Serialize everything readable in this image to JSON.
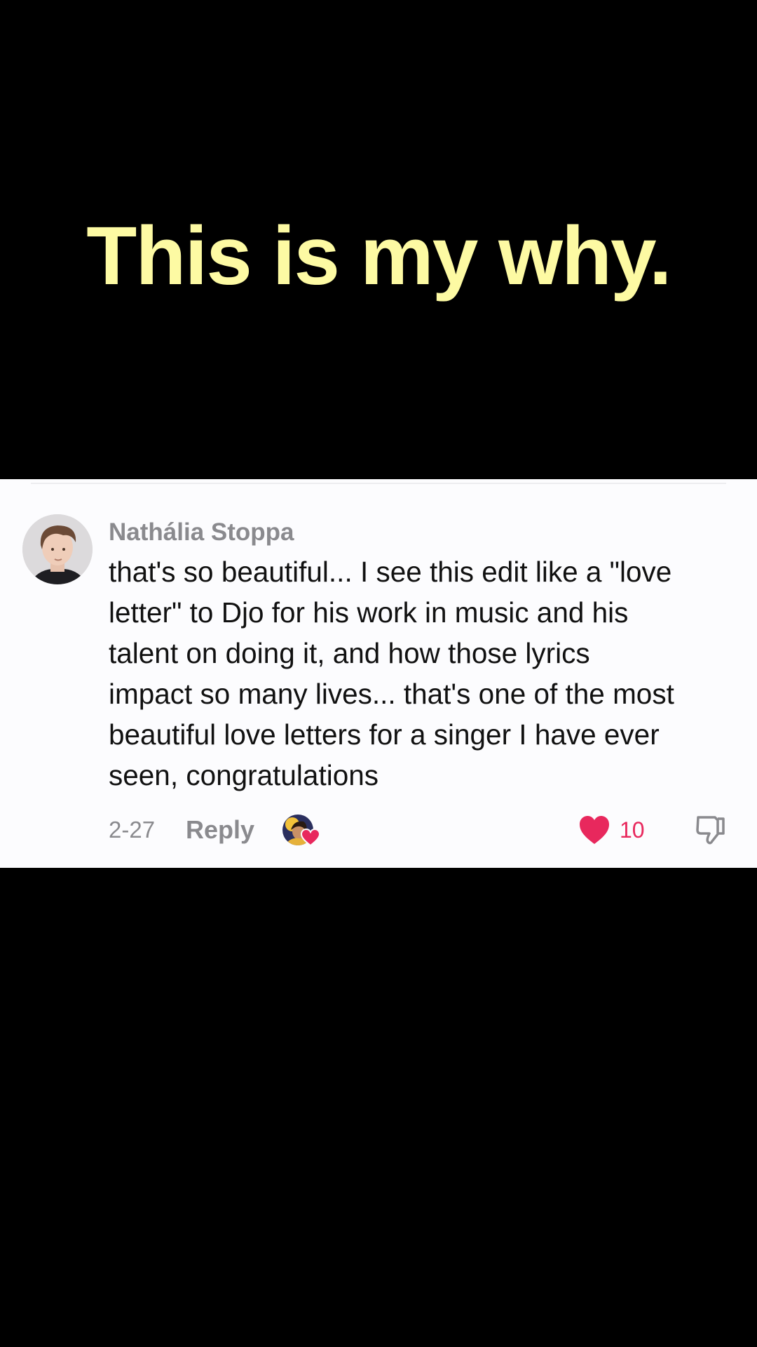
{
  "video": {
    "overlay_text": "This is my why."
  },
  "comment": {
    "username": "Nathália Stoppa",
    "text_lines": [
      "that's so beautiful... I see this edit like a \"love",
      "letter\" to Djo for his work in music and his",
      "talent on doing it, and how those lyrics",
      "impact so many lives... that's one of the most",
      "beautiful love letters for a singer I have ever",
      "seen, congratulations"
    ],
    "date": "2-27",
    "reply_label": "Reply",
    "like_count": "10",
    "liked": true,
    "liked_by_creator": true,
    "icons": {
      "avatar": "user-avatar",
      "creator_like": "creator-liked-avatar-icon",
      "like": "heart-icon",
      "dislike": "thumbs-down-icon"
    }
  },
  "colors": {
    "background": "#000000",
    "overlay_text": "#fdfaa3",
    "card_background": "#fcfcfe",
    "muted_text": "#8a8a8e",
    "like_accent": "#e8285d"
  }
}
